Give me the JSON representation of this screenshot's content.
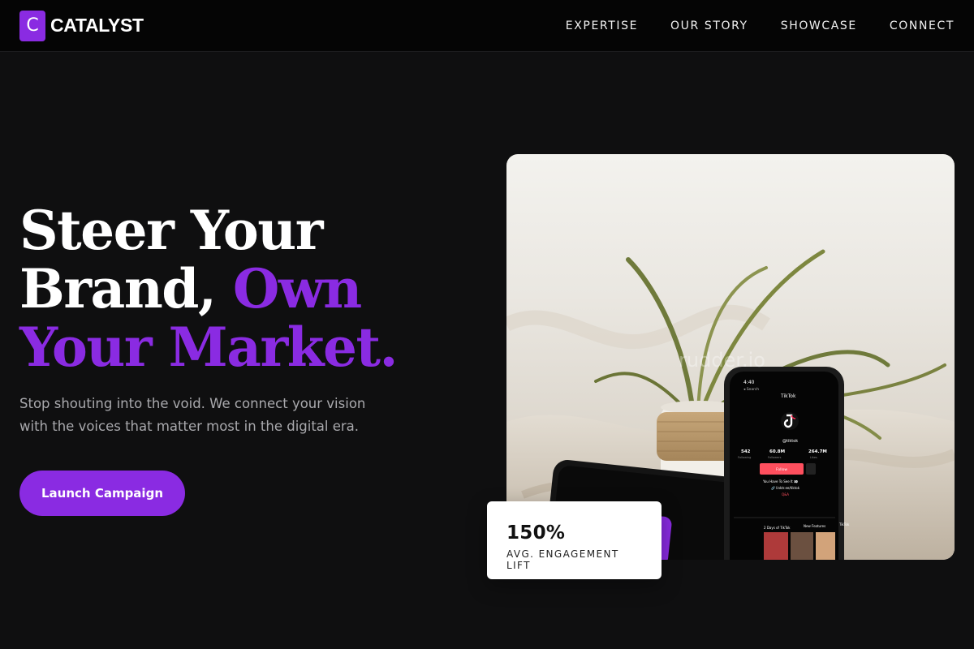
{
  "brand": {
    "mark": "C",
    "name": "CATALYST"
  },
  "nav": {
    "links": [
      "EXPERTISE",
      "OUR STORY",
      "SHOWCASE",
      "CONNECT"
    ]
  },
  "hero": {
    "title_line1": "Steer Your",
    "title_line2_plain": "Brand, ",
    "title_line2_accent": "Own",
    "title_line3_accent": "Your Market.",
    "subtitle": "Stop shouting into the void. We connect your vision with the voices that matter most in the digital era.",
    "cta_label": "Launch Campaign"
  },
  "image": {
    "watermark": "rudder.io",
    "phone_time": "4:40",
    "phone_search": "◂ Search",
    "app_title": "TikTok",
    "handle": "@tiktok",
    "stats": [
      {
        "value": "542",
        "label": "Following"
      },
      {
        "value": "60.8M",
        "label": "Followers"
      },
      {
        "value": "264.7M",
        "label": "Likes"
      }
    ],
    "follow_label": "Follow",
    "bio_line1": "You Have To See It 👀",
    "bio_line2": "🔗 linktr.ee/tiktok",
    "bio_line3": "Q&A",
    "row_left": "2 Days of TikTok",
    "row_mid": "New Features",
    "row_right": "TikTok"
  },
  "stat_card": {
    "value": "150%",
    "label": "AVG. ENGAGEMENT LIFT"
  },
  "colors": {
    "accent": "#8a2be2",
    "background": "#0f0f10",
    "nav": "#050505"
  }
}
